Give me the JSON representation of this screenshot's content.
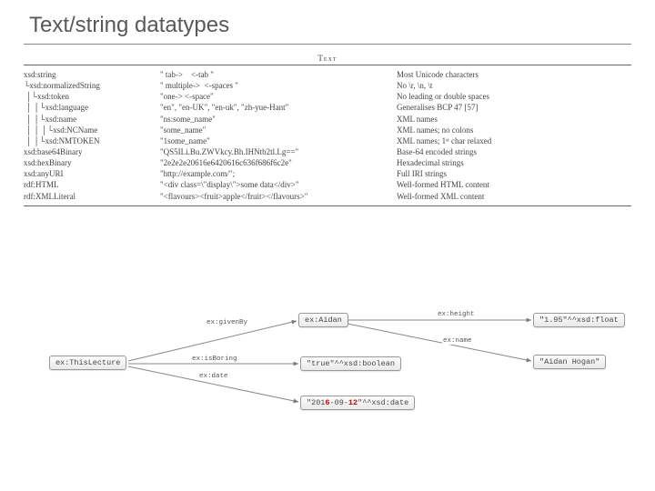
{
  "title": "Text/string datatypes",
  "caption": "Text",
  "rows": [
    {
      "name": "xsd:string",
      "ind": 0,
      "example": "\" tab->    <-tab \"",
      "desc": "Most Unicode characters"
    },
    {
      "name": "xsd:normalizedString",
      "ind": 1,
      "example": "\" multiple->  <-spaces \"",
      "desc": "No \\r, \\n, \\t"
    },
    {
      "name": "xsd:token",
      "ind": 2,
      "example": "\"one-> <-space\"",
      "desc": "No leading or double spaces"
    },
    {
      "name": "xsd:language",
      "ind": 3,
      "example": "\"en\", \"en-UK\", \"en-uk\", \"zh-yue-Hant\"",
      "desc": "Generalises BCP 47 [57]"
    },
    {
      "name": "xsd:name",
      "ind": 3,
      "example": "\"ns:some_name\"",
      "desc": "XML names"
    },
    {
      "name": "xsd:NCName",
      "ind": 4,
      "example": "\"some_name\"",
      "desc": "XML names; no colons"
    },
    {
      "name": "xsd:NMTOKEN",
      "ind": 3,
      "example": "\"1some_name\"",
      "desc": "XML names; 1ˢᵗ char relaxed"
    },
    {
      "name": "xsd:base64Binary",
      "ind": 0,
      "example": "\"QS5ILi.Bu.ZWVkcy.Bh.IHNtb2tl.Lg==\"",
      "desc": "Base-64 encoded strings"
    },
    {
      "name": "xsd:hexBinary",
      "ind": 0,
      "example": "\"2e2e2e20616e6420616c636f686f6c2e\"",
      "desc": "Hexadecimal strings"
    },
    {
      "name": "xsd:anyURI",
      "ind": 0,
      "example": "\"http://example.com/\";",
      "desc": "Full IRI strings"
    },
    {
      "name": "rdf:HTML",
      "ind": 0,
      "example": "\"<div class=\\\"display\\\">some data</div>\"",
      "desc": "Well-formed HTML content"
    },
    {
      "name": "rdf:XMLLiteral",
      "ind": 0,
      "example": "\"<flavours><fruit>apple</fruit></flavours>\"",
      "desc": "Well-formed XML content"
    }
  ],
  "graph": {
    "nodes": {
      "lecture": "ex:ThisLecture",
      "aidan": "ex:Aidan",
      "bool": "\"true\"^^xsd:boolean",
      "date_pre": "\"201",
      "date_a": "6",
      "date_mid": "-09-",
      "date_b": "12",
      "date_suf": "\"^^xsd:date",
      "height": "\"1.95\"^^xsd:float",
      "name": "\"Aidan Hogan\""
    },
    "edges": {
      "givenBy": "ex:givenBy",
      "isBoring": "ex:isBoring",
      "date": "ex:date",
      "height": "ex:height",
      "name": "ex:name"
    }
  }
}
